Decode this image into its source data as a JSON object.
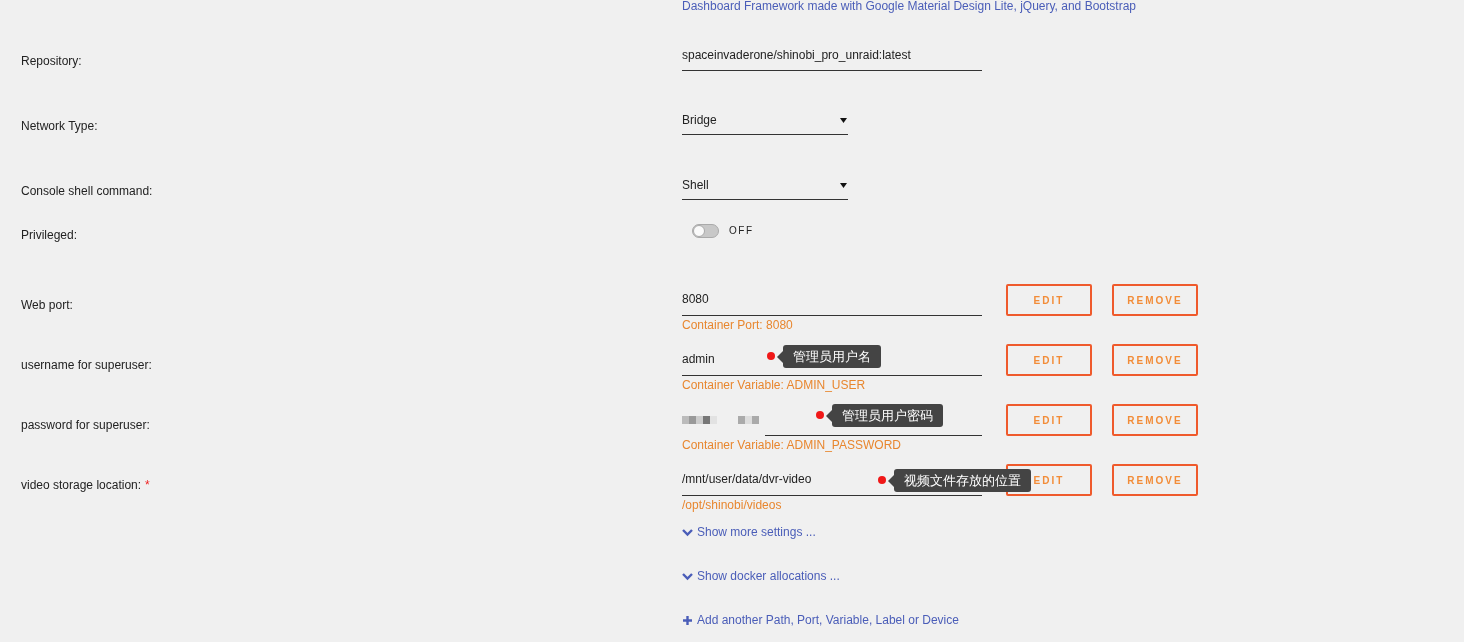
{
  "header_note": "Dashboard Framework made with Google Material Design Lite, jQuery, and Bootstrap",
  "settings": [
    {
      "kind": "text",
      "label": "Repository:",
      "value": "spaceinvaderone/shinobi_pro_unraid:latest"
    },
    {
      "kind": "select",
      "label": "Network Type:",
      "value": "Bridge"
    },
    {
      "kind": "select",
      "label": "Console shell command:",
      "value": "Shell"
    },
    {
      "kind": "toggle",
      "label": "Privileged:",
      "on": false,
      "state_text": "OFF"
    },
    {
      "kind": "config",
      "label": "Web port:",
      "value": "8080",
      "hint": "Container Port: 8080",
      "buttons": [
        "EDIT",
        "REMOVE"
      ]
    },
    {
      "kind": "config",
      "label": "username for superuser:",
      "value": "admin",
      "tooltip": "管理员用户名",
      "hint": "Container Variable: ADMIN_USER",
      "buttons": [
        "EDIT",
        "REMOVE"
      ]
    },
    {
      "kind": "config",
      "label": "password for superuser:",
      "masked": true,
      "tooltip": "管理员用户密码",
      "hint": "Container Variable: ADMIN_PASSWORD",
      "buttons": [
        "EDIT",
        "REMOVE"
      ]
    },
    {
      "kind": "config",
      "label": "video storage location:",
      "required_mark": "*",
      "value": "/mnt/user/data/dvr-video",
      "tooltip": "视频文件存放的位置",
      "hint": "/opt/shinobi/videos",
      "buttons": [
        "EDIT",
        "REMOVE"
      ]
    }
  ],
  "links": [
    {
      "kind": "expand",
      "text": "Show more settings ..."
    },
    {
      "kind": "expand",
      "text": "Show docker allocations ..."
    },
    {
      "kind": "add",
      "text": "Add another Path, Port, Variable, Label or Device"
    }
  ]
}
